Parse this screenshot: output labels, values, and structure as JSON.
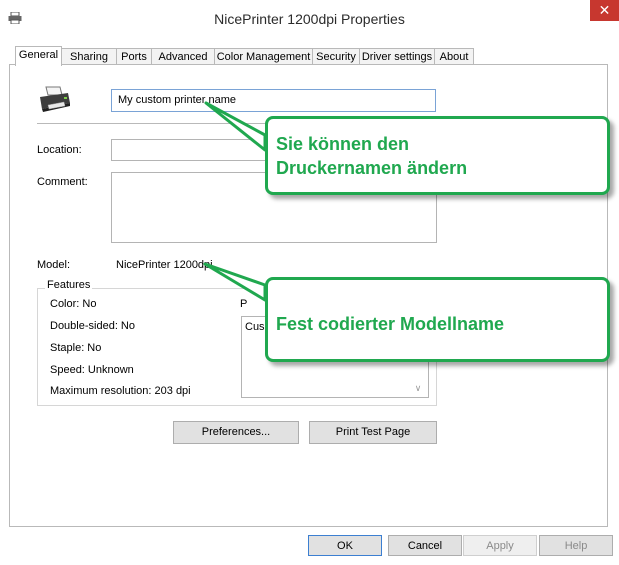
{
  "window": {
    "title": "NicePrinter 1200dpi Properties",
    "close_glyph": "✕"
  },
  "tabs": [
    {
      "label": "General",
      "active": true
    },
    {
      "label": "Sharing"
    },
    {
      "label": "Ports"
    },
    {
      "label": "Advanced"
    },
    {
      "label": "Color Management"
    },
    {
      "label": "Security"
    },
    {
      "label": "Driver settings"
    },
    {
      "label": "About"
    }
  ],
  "general": {
    "printer_name": "My custom printer name",
    "location_label": "Location:",
    "location_value": "",
    "comment_label": "Comment:",
    "comment_value": "",
    "model_label": "Model:",
    "model_value": "NicePrinter 1200dpi",
    "features_label": "Features",
    "features": [
      "Color: No",
      "Double-sided: No",
      "Staple: No",
      "Speed: Unknown",
      "Maximum resolution: 203 dpi"
    ],
    "paper_label_partial": "P",
    "paper_list_partial": "Cus",
    "preferences_button": "Preferences...",
    "print_test_button": "Print Test Page"
  },
  "footer": {
    "ok": "OK",
    "cancel": "Cancel",
    "apply": "Apply",
    "help": "Help"
  },
  "callouts": {
    "rename_line1": "Sie können den",
    "rename_line2": "Druckernamen ändern",
    "model": "Fest codierter Modellname"
  },
  "colors": {
    "callout_green": "#20a84f",
    "close_red": "#c7372f"
  }
}
